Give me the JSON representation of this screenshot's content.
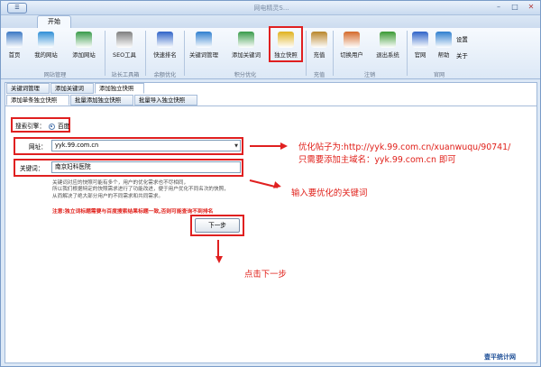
{
  "window": {
    "app_button": "☰",
    "title": "网电精灵S...",
    "controls": [
      "–",
      "□",
      "✕"
    ]
  },
  "ribbon": {
    "tab_label": "开始",
    "buttons": [
      {
        "label": "首页",
        "icon": "home-icon",
        "color": "#3b78c4"
      },
      {
        "label": "我的网站",
        "icon": "globe-icon",
        "color": "#2f8fd6"
      },
      {
        "label": "添加网站",
        "icon": "add-site-icon",
        "color": "#3a9b4a"
      },
      {
        "label": "SEO工具",
        "icon": "tools-icon",
        "color": "#7f7f7f"
      },
      {
        "label": "快速排名",
        "icon": "baidu-icon",
        "color": "#2f63c8"
      },
      {
        "label": "关键词管理",
        "icon": "network-icon",
        "color": "#2f7fcf"
      },
      {
        "label": "添加关键词",
        "icon": "add-keyword-icon",
        "color": "#3a9b4a"
      },
      {
        "label": "独立快照",
        "icon": "star-icon",
        "color": "#e0b21d"
      },
      {
        "label": "充值",
        "icon": "recharge-icon",
        "color": "#b8862b"
      },
      {
        "label": "切换用户",
        "icon": "switch-user-icon",
        "color": "#d46a2a"
      },
      {
        "label": "退出系统",
        "icon": "exit-icon",
        "color": "#3b9a34"
      },
      {
        "label": "官网",
        "icon": "website-icon",
        "color": "#2f63c8"
      },
      {
        "label": "帮助",
        "icon": "help-icon",
        "color": "#2f7fcf"
      }
    ],
    "side_items": [
      "设置",
      "关于"
    ],
    "groups": [
      "网站管理",
      "站长工具箱",
      "余额优化",
      "积分优化",
      "充值",
      "注销",
      "官网"
    ]
  },
  "tabs_top": [
    "关键词管理",
    "添加关键词",
    "添加独立快照"
  ],
  "tabs_sub": [
    "添加单条独立快照",
    "批量添加独立快照",
    "批量导入独立快照"
  ],
  "form": {
    "engine_label": "搜索引擎：",
    "engine_value": "百度",
    "url_label": "网址：",
    "url_value": "yyk.99.com.cn",
    "keyword_label": "关键词：",
    "keyword_value": "南京妇科医院",
    "desc": [
      "关键词对应的快照可能有多个，用户的优化需求也不尽相同，",
      "所以我们根据特定的快照需求进行了功能改进，便于用户优化不同名次的快照，",
      "从而解决了绝大部分用户的不同需求和共同需求。"
    ],
    "notice": "注意:独立词标题需要与百度搜索结果标题一致,否则可能查询不到排名",
    "next_button": "下一步"
  },
  "annotations": {
    "url_line1": "优化帖子为:http://yyk.99.com.cn/xuanwuqu/90741/",
    "url_line2": "只需要添加主域名：yyk.99.com.cn  即可",
    "keyword": "输入要优化的关键词",
    "next": "点击下一步"
  },
  "watermark": "壹平统计网"
}
